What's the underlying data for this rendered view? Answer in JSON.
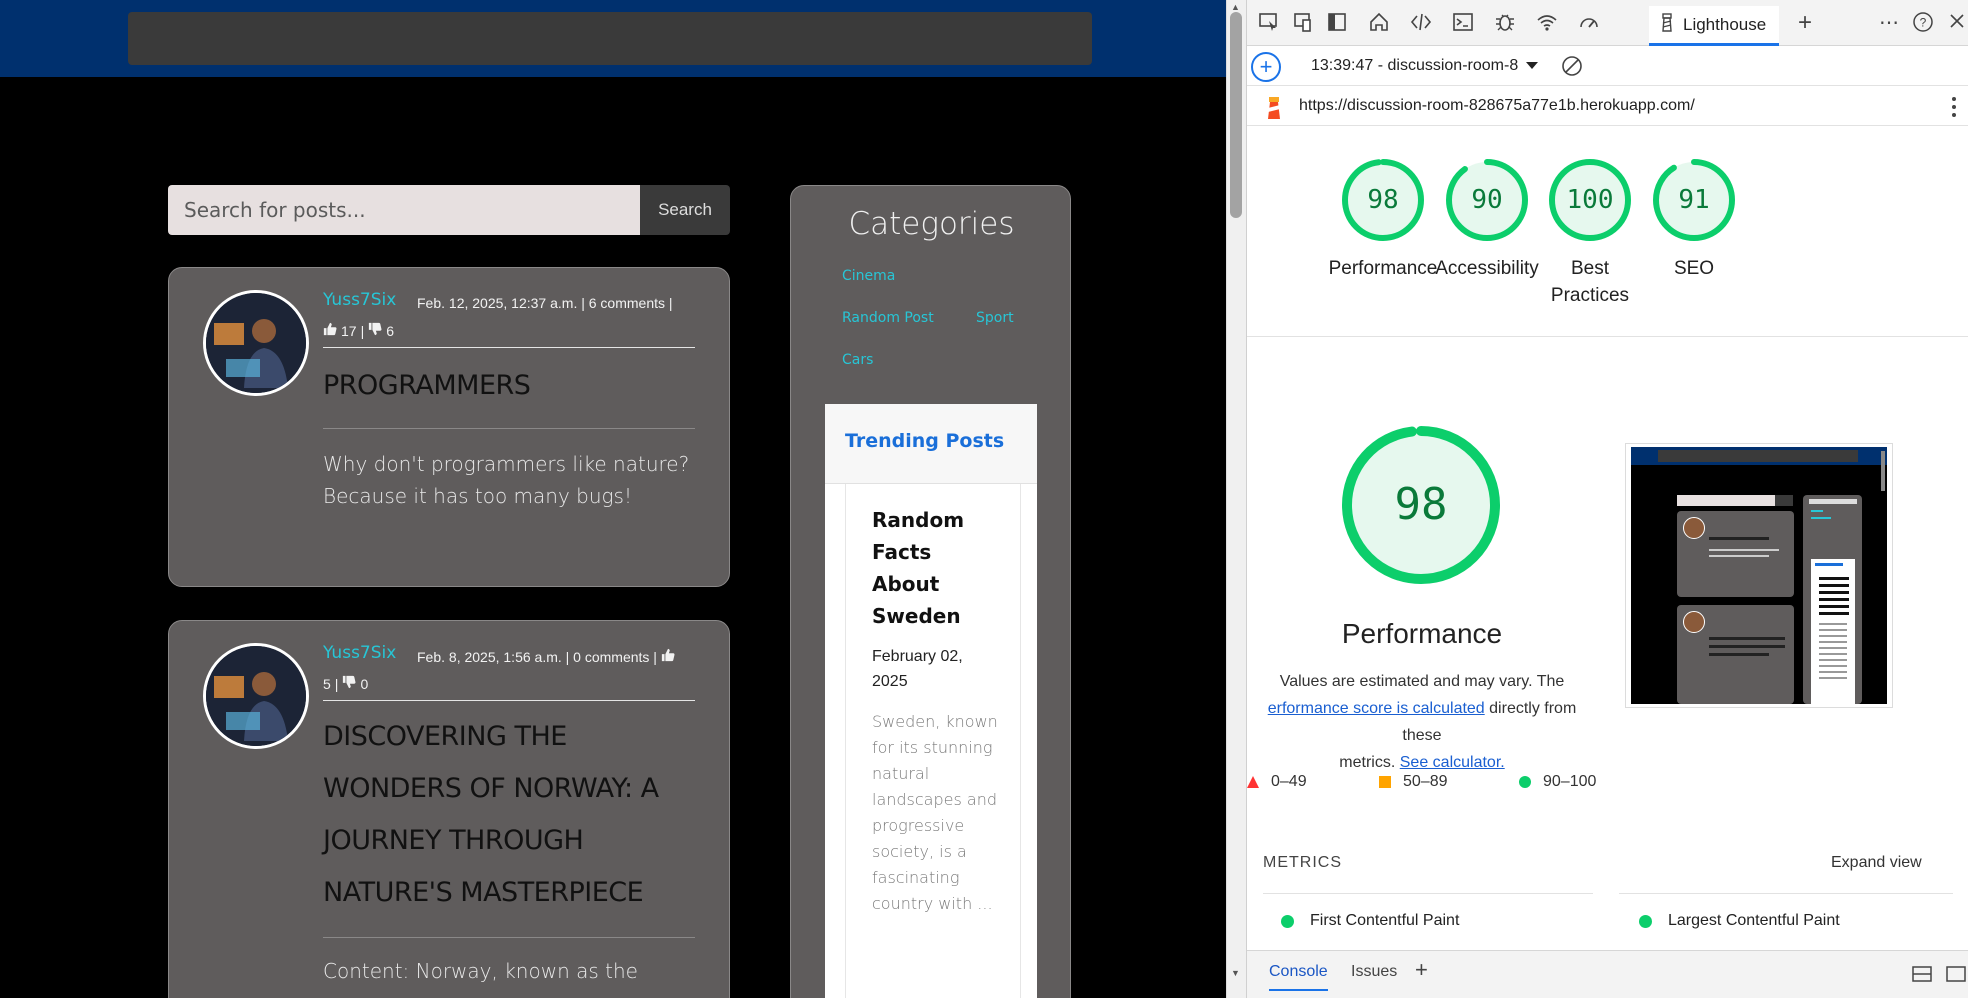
{
  "site": {
    "search": {
      "placeholder": "Search for posts...",
      "button": "Search"
    },
    "posts": [
      {
        "author": "Yuss7Six",
        "meta_line1": "Feb. 12, 2025, 12:37 a.m. | 6 comments |",
        "likes": "17",
        "dislikes": "6",
        "title": "PROGRAMMERS",
        "body": "Why don't programmers like nature? Because it has too many bugs!"
      },
      {
        "author": "Yuss7Six",
        "meta_line1": "Feb. 8, 2025, 1:56 a.m. | 0 comments |",
        "likes": "5",
        "dislikes": "0",
        "title": "DISCOVERING THE WONDERS OF NORWAY: A JOURNEY THROUGH NATURE'S MASTERPIECE",
        "body": "Content: Norway, known as the"
      }
    ],
    "categories": {
      "title": "Categories",
      "items": [
        "Cinema",
        "Random Post",
        "Sport",
        "Cars"
      ]
    },
    "trending": {
      "title": "Trending Posts",
      "post_title": "Random Facts About Sweden",
      "date": "February 02, 2025",
      "excerpt": "Sweden, known for its stunning natural landscapes and progressive society, is a fascinating country with ..."
    }
  },
  "devtools": {
    "active_tab": "Lighthouse",
    "run_label": "13:39:47 - discussion-room-8",
    "url": "https://discussion-room-828675a77e1b.herokuapp.com/",
    "scores": [
      {
        "label": "Performance",
        "value": "98",
        "fraction": 0.98
      },
      {
        "label": "Accessibility",
        "value": "90",
        "fraction": 0.9
      },
      {
        "label": "Best Practices",
        "value": "100",
        "fraction": 1.0
      },
      {
        "label": "SEO",
        "value": "91",
        "fraction": 0.91
      }
    ],
    "performance": {
      "value": "98",
      "title": "Performance",
      "note_1": "Values are estimated and may vary. The",
      "note_link_1": "erformance score is calculated",
      "note_2": "directly from these",
      "note_3": "metrics.",
      "note_link_2": "See calculator."
    },
    "legend": [
      {
        "label": "0–49",
        "color": "#ff3333"
      },
      {
        "label": "50–89",
        "color": "#ffa400"
      },
      {
        "label": "90–100",
        "color": "#0cce6b"
      }
    ],
    "metrics": {
      "title": "METRICS",
      "expand": "Expand view",
      "items": [
        "First Contentful Paint",
        "Largest Contentful Paint"
      ]
    },
    "drawer": {
      "tabs": [
        "Console",
        "Issues"
      ]
    },
    "colors": {
      "pass": "#0cce6b",
      "accent": "#1a73e8"
    }
  }
}
